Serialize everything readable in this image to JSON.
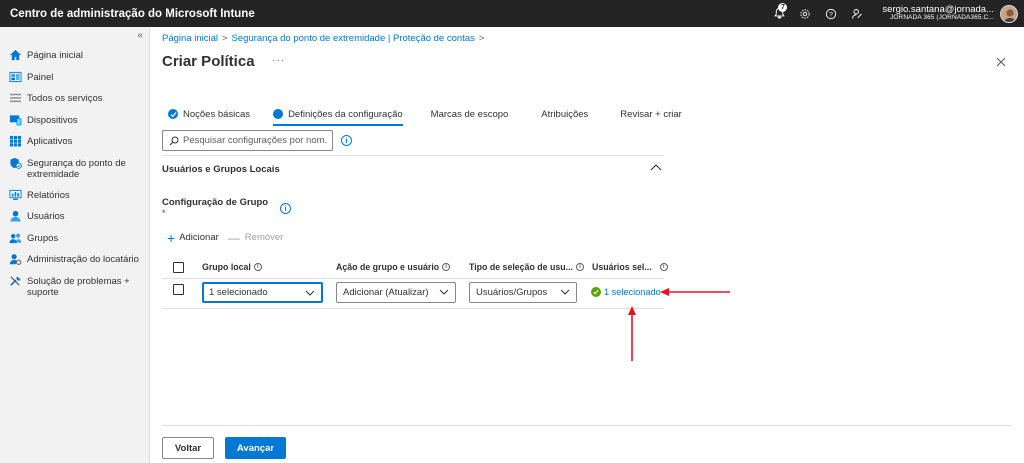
{
  "app": {
    "title": "Centro de administração do Microsoft Intune",
    "notification_count": "7",
    "user": "sergio.santana@jornada...",
    "tenant": "JORNADA 365 (JORNADA365.C..."
  },
  "sidebar": {
    "collapse": "«",
    "items": [
      {
        "label": "Página inicial",
        "icon": "home-icon"
      },
      {
        "label": "Painel",
        "icon": "dashboard-icon"
      },
      {
        "label": "Todos os serviços",
        "icon": "all-services-icon"
      },
      {
        "label": "Dispositivos",
        "icon": "devices-icon"
      },
      {
        "label": "Aplicativos",
        "icon": "apps-icon"
      },
      {
        "label": "Segurança do ponto de extremidade",
        "icon": "endpoint-security-icon"
      },
      {
        "label": "Relatórios",
        "icon": "reports-icon"
      },
      {
        "label": "Usuários",
        "icon": "users-icon"
      },
      {
        "label": "Grupos",
        "icon": "groups-icon"
      },
      {
        "label": "Administração do locatário",
        "icon": "tenant-admin-icon"
      },
      {
        "label": "Solução de problemas + suporte",
        "icon": "troubleshoot-icon"
      }
    ]
  },
  "breadcrumb": [
    "Página inicial",
    "Segurança do ponto de extremidade | Proteção de contas"
  ],
  "page": {
    "title": "Criar Política",
    "more": "···"
  },
  "tabs": [
    {
      "label": "Noções básicas",
      "state": "done"
    },
    {
      "label": "Definições da configuração",
      "state": "active"
    },
    {
      "label": "Marcas de escopo",
      "state": ""
    },
    {
      "label": "Atribuições",
      "state": ""
    },
    {
      "label": "Revisar + criar",
      "state": ""
    }
  ],
  "search": {
    "placeholder": "Pesquisar configurações por nom..."
  },
  "section": {
    "title": "Usuários e Grupos Locais"
  },
  "group_config": {
    "title": "Configuração de Grupo",
    "required": "*"
  },
  "toolbar": {
    "add_label": "Adicionar",
    "remove_label": "Remover"
  },
  "table": {
    "columns": [
      "Grupo local",
      "Ação de grupo e usuário",
      "Tipo de seleção de usu...",
      "Usuários sel..."
    ],
    "rows": [
      {
        "local_group": "1 selecionado",
        "action": "Adicionar (Atualizar)",
        "selection_type": "Usuários/Grupos",
        "users_selected": "1 selecionado"
      }
    ]
  },
  "footer": {
    "back_label": "Voltar",
    "next_label": "Avançar"
  },
  "colors": {
    "accent": "#0078d4",
    "topbar": "#242424",
    "annotation": "#e81123",
    "success": "#57a300"
  }
}
